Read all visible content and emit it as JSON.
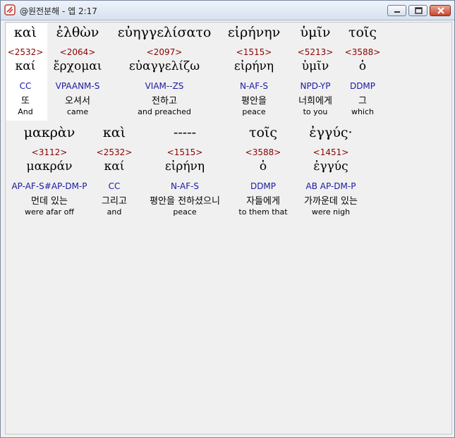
{
  "window": {
    "title": "@원전분해 - 엡 2:17",
    "icons": {
      "app": "app-icon",
      "minimize": "minimize-icon",
      "maximize": "maximize-icon",
      "close": "close-icon"
    }
  },
  "rows": [
    {
      "words": [
        {
          "greek": "καὶ",
          "strong": "<2532>",
          "lemma": "καί",
          "morph": "CC",
          "korean": "또",
          "english": "And"
        },
        {
          "greek": "ἐλθὼν",
          "strong": "<2064>",
          "lemma": "ἔρχομαι",
          "morph": "VPAANM-S",
          "korean": "오셔서",
          "english": "came"
        },
        {
          "greek": "εὐηγγελίσατο",
          "strong": "<2097>",
          "lemma": "εὐαγγελίζω",
          "morph": "VIAM--ZS",
          "korean": "전하고",
          "english": "and preached"
        },
        {
          "greek": "εἰρήνην",
          "strong": "<1515>",
          "lemma": "εἰρήνη",
          "morph": "N-AF-S",
          "korean": "평안을",
          "english": "peace"
        },
        {
          "greek": "ὑμῖν",
          "strong": "<5213>",
          "lemma": "ὑμῖν",
          "morph": "NPD-YP",
          "korean": "너희에게",
          "english": "to you"
        },
        {
          "greek": "τοῖς",
          "strong": "<3588>",
          "lemma": "ὁ",
          "morph": "DDMP",
          "korean": "그",
          "english": "which"
        }
      ]
    },
    {
      "words": [
        {
          "greek": "μακρὰν",
          "strong": "<3112>",
          "lemma": "μακράν",
          "morph": "AP-AF-S#AP-DM-P",
          "korean": "먼데 있는",
          "english": "were afar off"
        },
        {
          "greek": "καὶ",
          "strong": "<2532>",
          "lemma": "καί",
          "morph": "CC",
          "korean": "그리고",
          "english": "and"
        },
        {
          "greek": "-----",
          "strong": "<1515>",
          "lemma": "εἰρήνη",
          "morph": "N-AF-S",
          "korean": "평안을 전하셨으니",
          "english": "peace"
        },
        {
          "greek": "τοῖς",
          "strong": "<3588>",
          "lemma": "ὁ",
          "morph": "DDMP",
          "korean": "자들에게",
          "english": "to them that"
        },
        {
          "greek": "ἐγγύς·",
          "strong": "<1451>",
          "lemma": "ἐγγύς",
          "morph": "AB AP-DM-P",
          "korean": "가까운데 있는",
          "english": "were nigh"
        }
      ]
    }
  ]
}
